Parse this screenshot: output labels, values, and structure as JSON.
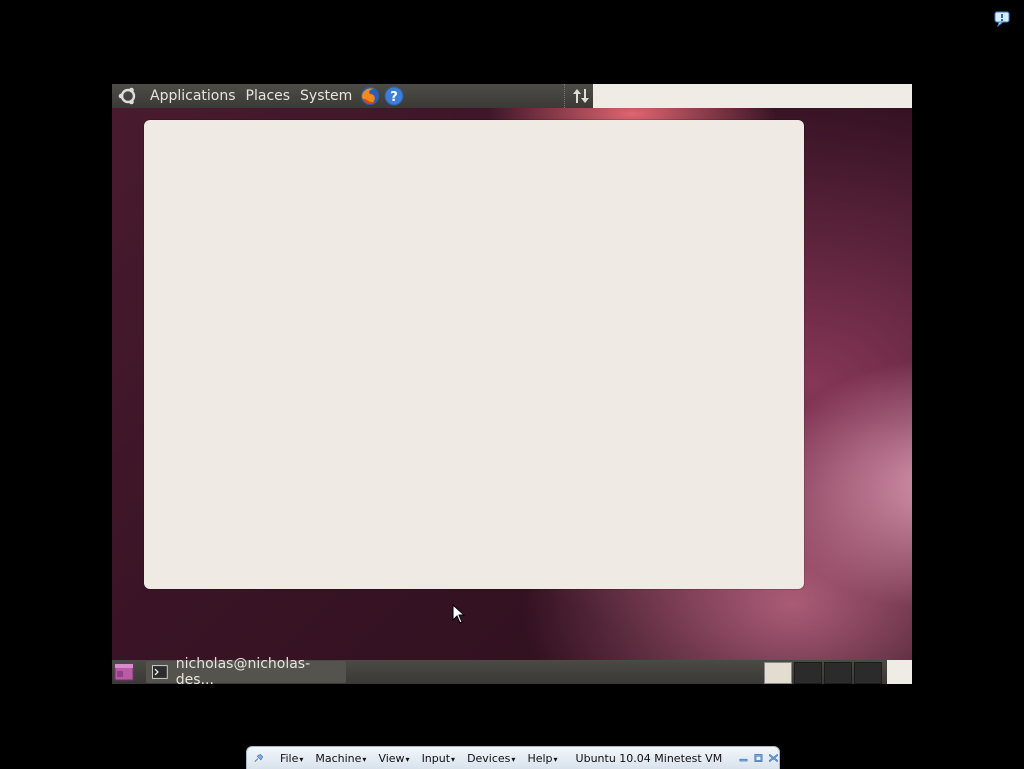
{
  "host": {
    "notification_icon": "notification-balloon-icon"
  },
  "guest": {
    "top_panel": {
      "logo_icon": "ubuntu-logo-icon",
      "menus": [
        {
          "label": "Applications"
        },
        {
          "label": "Places"
        },
        {
          "label": "System"
        }
      ],
      "launchers": [
        "firefox-icon",
        "help-icon"
      ],
      "indicator_icon": "network-updown-icon"
    },
    "bottom_panel": {
      "show_desktop_icon": "show-desktop-icon",
      "tasks": [
        {
          "label": "nicholas@nicholas-des...",
          "icon": "terminal-icon"
        }
      ],
      "workspaces": 4,
      "active_workspace": 1
    }
  },
  "vbox_toolbar": {
    "pin_icon": "pin-icon",
    "menus": [
      {
        "label": "File"
      },
      {
        "label": "Machine"
      },
      {
        "label": "View"
      },
      {
        "label": "Input"
      },
      {
        "label": "Devices"
      },
      {
        "label": "Help"
      }
    ],
    "vm_title": "Ubuntu 10.04 Minetest VM",
    "buttons": [
      "minimize-icon",
      "restore-icon",
      "close-icon"
    ]
  },
  "colors": {
    "panel": "#3b3a36",
    "dialog": "#efebe4",
    "wallpaper_dark": "#3a1426",
    "wallpaper_glow": "#e7a0bd"
  }
}
